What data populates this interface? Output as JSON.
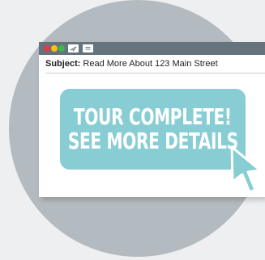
{
  "email": {
    "subject_label": "Subject:",
    "subject_text": "Read More About 123 Main Street"
  },
  "cta": {
    "line1": "TOUR COMPLETE!",
    "line2": "SEE MORE DETAILS"
  },
  "titlebar": {
    "icons": [
      "close-dot",
      "minimize-dot",
      "maximize-dot",
      "send-icon",
      "menu-icon"
    ]
  },
  "colors": {
    "background": "#eeeff0",
    "circle": "#b4bbc0",
    "titlebar": "#65737c",
    "cta": "#88cdd4",
    "cursor": "#88cdd4"
  }
}
